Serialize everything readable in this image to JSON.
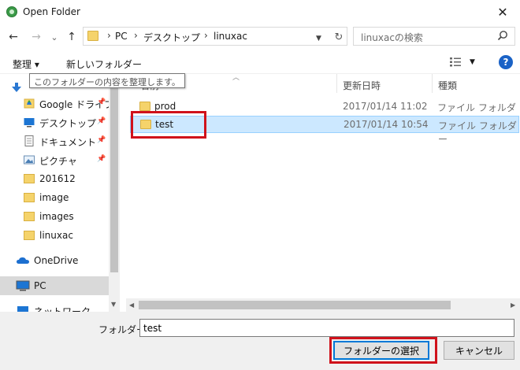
{
  "window": {
    "title": "Open Folder",
    "close": "✕"
  },
  "nav": {
    "back": "←",
    "forward": "→",
    "recent": "⌄",
    "up": "↑",
    "breadcrumb": [
      "PC",
      "デスクトップ",
      "linuxac"
    ],
    "separator": "›",
    "search_placeholder": "linuxacの検索"
  },
  "toolbar": {
    "organize": "整理 ▾",
    "new_folder": "新しいフォルダー",
    "tooltip": "このフォルダーの内容を整理します。"
  },
  "sidebar": {
    "items": [
      {
        "label": "Google ドライブ",
        "icon": "google-drive-icon",
        "pinned": true
      },
      {
        "label": "デスクトップ",
        "icon": "desktop-icon",
        "pinned": true
      },
      {
        "label": "ドキュメント",
        "icon": "document-icon",
        "pinned": true
      },
      {
        "label": "ピクチャ",
        "icon": "picture-icon",
        "pinned": true
      },
      {
        "label": "201612",
        "icon": "folder-icon"
      },
      {
        "label": "image",
        "icon": "folder-icon"
      },
      {
        "label": "images",
        "icon": "folder-icon"
      },
      {
        "label": "linuxac",
        "icon": "folder-icon"
      },
      {
        "label": "OneDrive",
        "icon": "onedrive-icon"
      },
      {
        "label": "PC",
        "icon": "pc-icon",
        "selected": true
      },
      {
        "label": "ネットワーク",
        "icon": "network-icon"
      }
    ]
  },
  "columns": {
    "name": "名前",
    "date": "更新日時",
    "type": "種類"
  },
  "files": [
    {
      "name": "prod",
      "date": "2017/01/14 11:02",
      "type": "ファイル フォルダー"
    },
    {
      "name": "test",
      "date": "2017/01/14 10:54",
      "type": "ファイル フォルダー",
      "selected": true
    }
  ],
  "footer": {
    "folder_label": "フォルダー:",
    "folder_value": "test",
    "select_button": "フォルダーの選択",
    "cancel_button": "キャンセル"
  },
  "colors": {
    "highlight": "#d0121b",
    "selection": "#cce8ff",
    "folder": "#f5d36b",
    "accent": "#0078d7"
  }
}
